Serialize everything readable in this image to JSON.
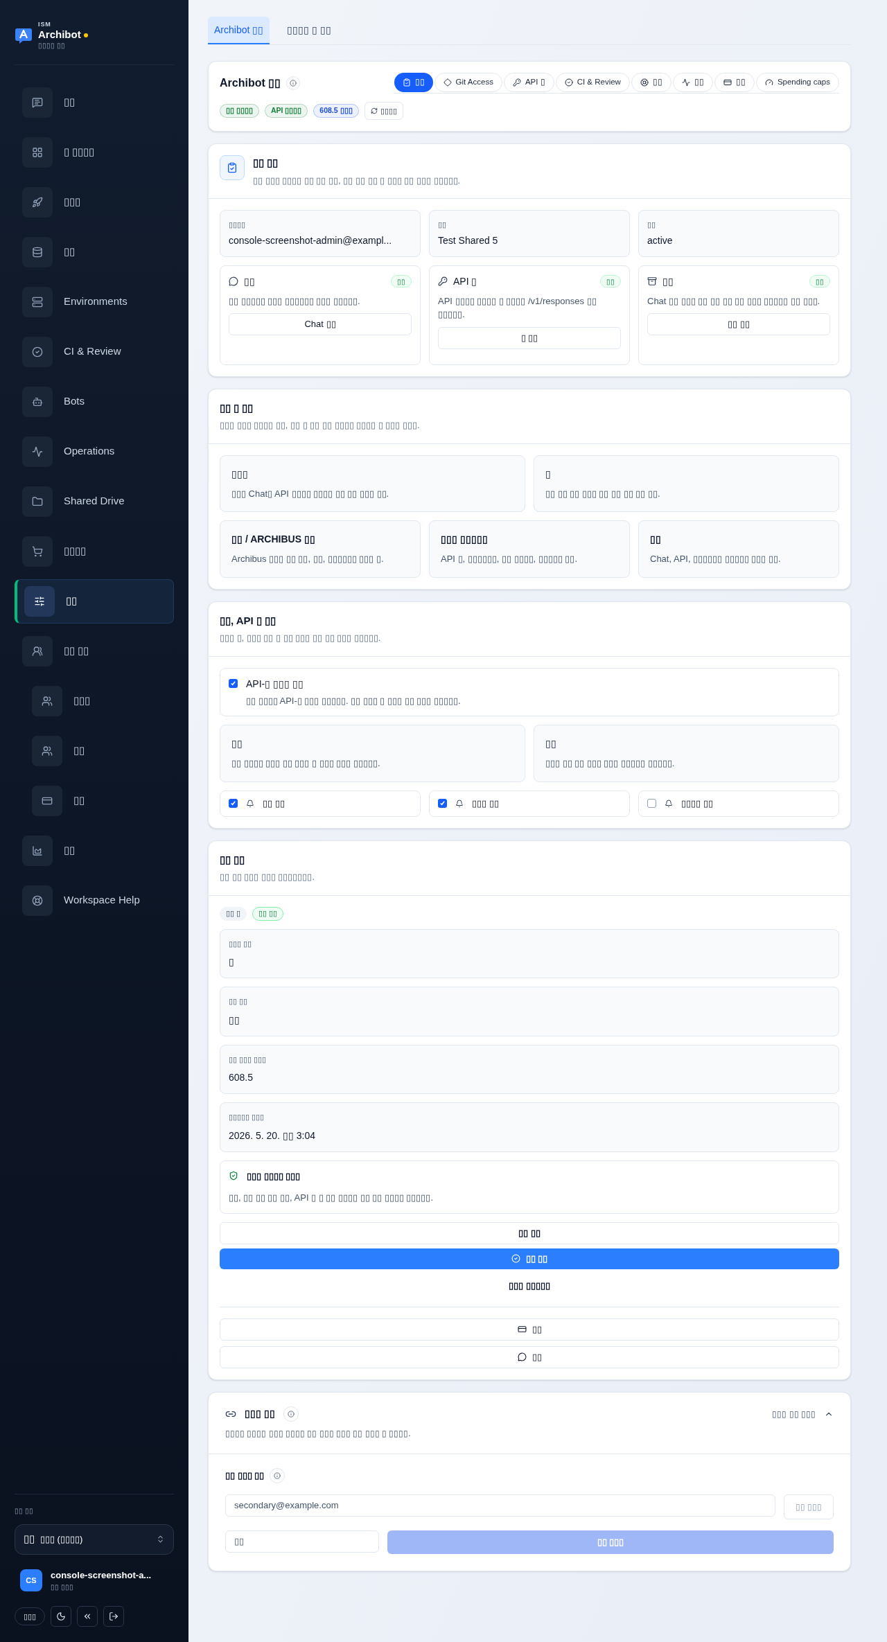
{
  "sidebar": {
    "brand": {
      "overline": "ISM",
      "name": "Archibot",
      "subtitle": "▯▯▯▯ ▯▯"
    },
    "nav": [
      {
        "label": "▯▯",
        "selected": false
      },
      {
        "label": "▯ ▯▯▯▯",
        "selected": false
      },
      {
        "label": "▯▯▯",
        "selected": false
      },
      {
        "label": "▯▯",
        "selected": false
      },
      {
        "label": "Environments",
        "selected": false
      },
      {
        "label": "CI & Review",
        "selected": false
      },
      {
        "label": "Bots",
        "selected": false
      },
      {
        "label": "Operations",
        "selected": false
      },
      {
        "label": "Shared Drive",
        "selected": false
      },
      {
        "label": "▯▯▯▯",
        "selected": false
      },
      {
        "label": "▯▯",
        "selected": true
      },
      {
        "label": "▯▯ ▯▯",
        "selected": false,
        "children": [
          {
            "label": "▯▯▯",
            "selected": false
          },
          {
            "label": "▯▯",
            "selected": false
          },
          {
            "label": "▯▯",
            "selected": false
          }
        ]
      },
      {
        "label": "▯▯",
        "selected": false
      },
      {
        "label": "Workspace Help",
        "selected": false
      }
    ],
    "workspace_label": "▯▯ ▯▯",
    "workspace_select": {
      "prefix": "▯▯",
      "value": "▯▯▯ (▯▯▯▯)"
    },
    "user": {
      "initials": "CS",
      "name": "console-screenshot-a...",
      "role": "▯▯ ▯▯▯"
    },
    "footer_buttons": [
      {
        "kind": "language",
        "label": "▯▯▯"
      },
      {
        "kind": "theme"
      },
      {
        "kind": "collapse"
      },
      {
        "kind": "logout"
      }
    ]
  },
  "tabs": [
    {
      "label": "Archibot ▯▯",
      "selected": true
    },
    {
      "label": "▯▯▯▯ ▯ ▯▯",
      "selected": false
    }
  ],
  "header": {
    "title": "Archibot ▯▯",
    "sections": [
      {
        "label": "▯▯",
        "selected": true
      },
      {
        "label": "Git Access",
        "selected": false
      },
      {
        "label": "API ▯",
        "selected": false
      },
      {
        "label": "CI & Review",
        "selected": false
      },
      {
        "label": "▯▯",
        "selected": false
      },
      {
        "label": "▯▯",
        "selected": false
      },
      {
        "label": "▯▯",
        "selected": false
      },
      {
        "label": "Spending caps",
        "selected": false
      }
    ],
    "badges": [
      {
        "label": "▯▯ ▯▯▯▯",
        "color": "#15803d"
      },
      {
        "label": "API ▯▯▯▯",
        "color": "#15803d"
      },
      {
        "label": "608.5 ▯▯▯",
        "color": "#1d4ed8"
      }
    ],
    "refresh_button": "▯▯▯▯"
  },
  "overview": {
    "title": "▯▯ ▯▯",
    "description": "▯▯ ▯▯▯ ▯▯▯▯ ▯▯ ▯▯ ▯▯, ▯▯ ▯▯ ▯▯ ▯ ▯▯▯ ▯▯ ▯▯▯ ▯▯▯▯▯.",
    "info": [
      {
        "label": "▯▯▯▯",
        "value": "console-screenshot-admin@exampl..."
      },
      {
        "label": "▯▯",
        "value": "Test Shared 5"
      },
      {
        "label": "▯▯",
        "value": "active"
      }
    ],
    "features": [
      {
        "title": "▯▯",
        "badge": "▯▯",
        "description": "▯▯ ▯▯▯▯▯ ▯▯▯ ▯▯▯▯▯▯ ▯▯▯ ▯▯▯▯▯.",
        "button": "Chat ▯▯"
      },
      {
        "title": "API ▯",
        "badge": "▯▯",
        "description": "API ▯▯▯▯ ▯▯▯▯ ▯ ▯▯▯▯ /v1/responses ▯▯ ▯▯▯▯▯.",
        "button": "▯ ▯▯"
      },
      {
        "title": "▯▯",
        "badge": "▯▯",
        "description": "Chat ▯▯ ▯▯▯ ▯▯ ▯▯ ▯▯ ▯▯ ▯▯▯ ▯▯▯▯▯ ▯▯ ▯▯▯.",
        "button": "▯▯ ▯▯"
      }
    ]
  },
  "modes": {
    "title": "▯▯ ▯ ▯▯",
    "description": "▯▯▯ ▯▯▯ ▯▯▯▯ ▯▯, ▯▯ ▯ ▯▯ ▯▯ ▯▯▯▯ ▯▯▯▯ ▯ ▯▯▯ ▯▯▯.",
    "tiles": [
      {
        "title": "▯▯▯",
        "description": "▯▯▯ Chat▯ API ▯▯▯▯ ▯▯▯▯ ▯▯ ▯▯ ▯▯▯ ▯▯."
      },
      {
        "title": "▯",
        "description": "▯▯ ▯▯ ▯▯ ▯▯▯ ▯▯ ▯▯ ▯▯ ▯▯ ▯▯."
      },
      {
        "title": "▯▯ / ARCHIBUS ▯▯",
        "description": "Archibus ▯▯▯ ▯▯ ▯▯, ▯▯, ▯▯▯▯▯▯ ▯▯▯ ▯."
      },
      {
        "title": "▯▯▯ ▯▯▯▯▯",
        "description": "API ▯, ▯▯▯▯▯▯, ▯▯ ▯▯▯▯, ▯▯▯▯▯ ▯▯."
      },
      {
        "title": "▯▯",
        "description": "Chat, API, ▯▯▯▯▯▯ ▯▯▯▯▯ ▯▯▯ ▯▯."
      }
    ]
  },
  "access": {
    "title": "▯▯, API ▯ ▯▯",
    "description": "▯▯▯ ▯, ▯▯▯ ▯▯ ▯ ▯▯ ▯▯▯ ▯▯ ▯▯ ▯▯▯ ▯▯▯▯▯.",
    "api_only": {
      "label": "API-▯ ▯▯▯ ▯▯",
      "description": "▯▯ ▯▯▯▯ API-▯ ▯▯▯ ▯▯▯▯▯. ▯▯ ▯▯▯ ▯ ▯▯▯ ▯▯ ▯▯▯ ▯▯▯▯▯.",
      "checked": true
    },
    "tiles": [
      {
        "title": "▯▯",
        "description": "▯▯ ▯▯▯▯ ▯▯▯ ▯▯ ▯▯▯ ▯ ▯▯▯ ▯▯▯ ▯▯▯▯▯."
      },
      {
        "title": "▯▯",
        "description": "▯▯▯ ▯▯ ▯▯ ▯▯▯ ▯▯▯ ▯▯▯▯▯ ▯▯▯▯▯."
      }
    ],
    "notifications": [
      {
        "label": "▯▯ ▯▯",
        "checked": true
      },
      {
        "label": "▯▯▯ ▯▯",
        "checked": true
      },
      {
        "label": "▯▯▯▯ ▯▯",
        "checked": false
      }
    ]
  },
  "status": {
    "title": "▯▯ ▯▯",
    "description": "▯▯ ▯▯ ▯▯▯ ▯▯▯ ▯▯▯▯▯▯▯.",
    "tags": [
      {
        "label": "▯▯ ▯",
        "kind": "neutral"
      },
      {
        "label": "▯▯ ▯▯",
        "kind": "success"
      }
    ],
    "fields": [
      {
        "label": "▯▯▯ ▯▯",
        "value": "▯"
      },
      {
        "label": "▯▯ ▯▯",
        "value": "▯▯"
      },
      {
        "label": "▯▯ ▯▯▯ ▯▯▯",
        "value": "608.5"
      },
      {
        "label": "▯▯▯▯▯ ▯▯▯",
        "value": "2026. 5. 20. ▯▯ 3:04"
      }
    ],
    "notice": {
      "title": "▯▯▯ ▯▯▯▯ ▯▯▯",
      "description": "▯▯, ▯▯ ▯▯ ▯▯ ▯▯, API ▯ ▯ ▯▯ ▯▯▯▯ ▯▯ ▯▯ ▯▯▯▯ ▯▯▯▯▯."
    },
    "actions": [
      {
        "label": "▯▯ ▯▯",
        "kind": "outline"
      },
      {
        "label": "▯▯ ▯▯",
        "kind": "primary"
      },
      {
        "label": "▯▯▯ ▯▯▯▯▯",
        "kind": "text"
      }
    ],
    "links": [
      {
        "label": "▯▯"
      },
      {
        "label": "▯▯"
      }
    ]
  },
  "linking": {
    "title": "▯▯▯ ▯▯",
    "expanded": true,
    "toggle_label": "▯▯▯ ▯▯ ▯▯▯",
    "description": "▯▯▯▯ ▯▯▯▯ ▯▯▯ ▯▯▯▯ ▯▯ ▯▯▯ ▯▯▯ ▯▯ ▯▯▯ ▯ ▯▯▯▯.",
    "subtitle": "▯▯ ▯▯▯ ▯▯",
    "email_field": {
      "value": "secondary@example.com"
    },
    "add_button": {
      "label": "▯▯ ▯▯▯",
      "disabled": true
    },
    "code_field": {
      "placeholder": "▯▯"
    },
    "submit_button": {
      "label": "▯▯ ▯▯▯",
      "disabled": true
    }
  }
}
